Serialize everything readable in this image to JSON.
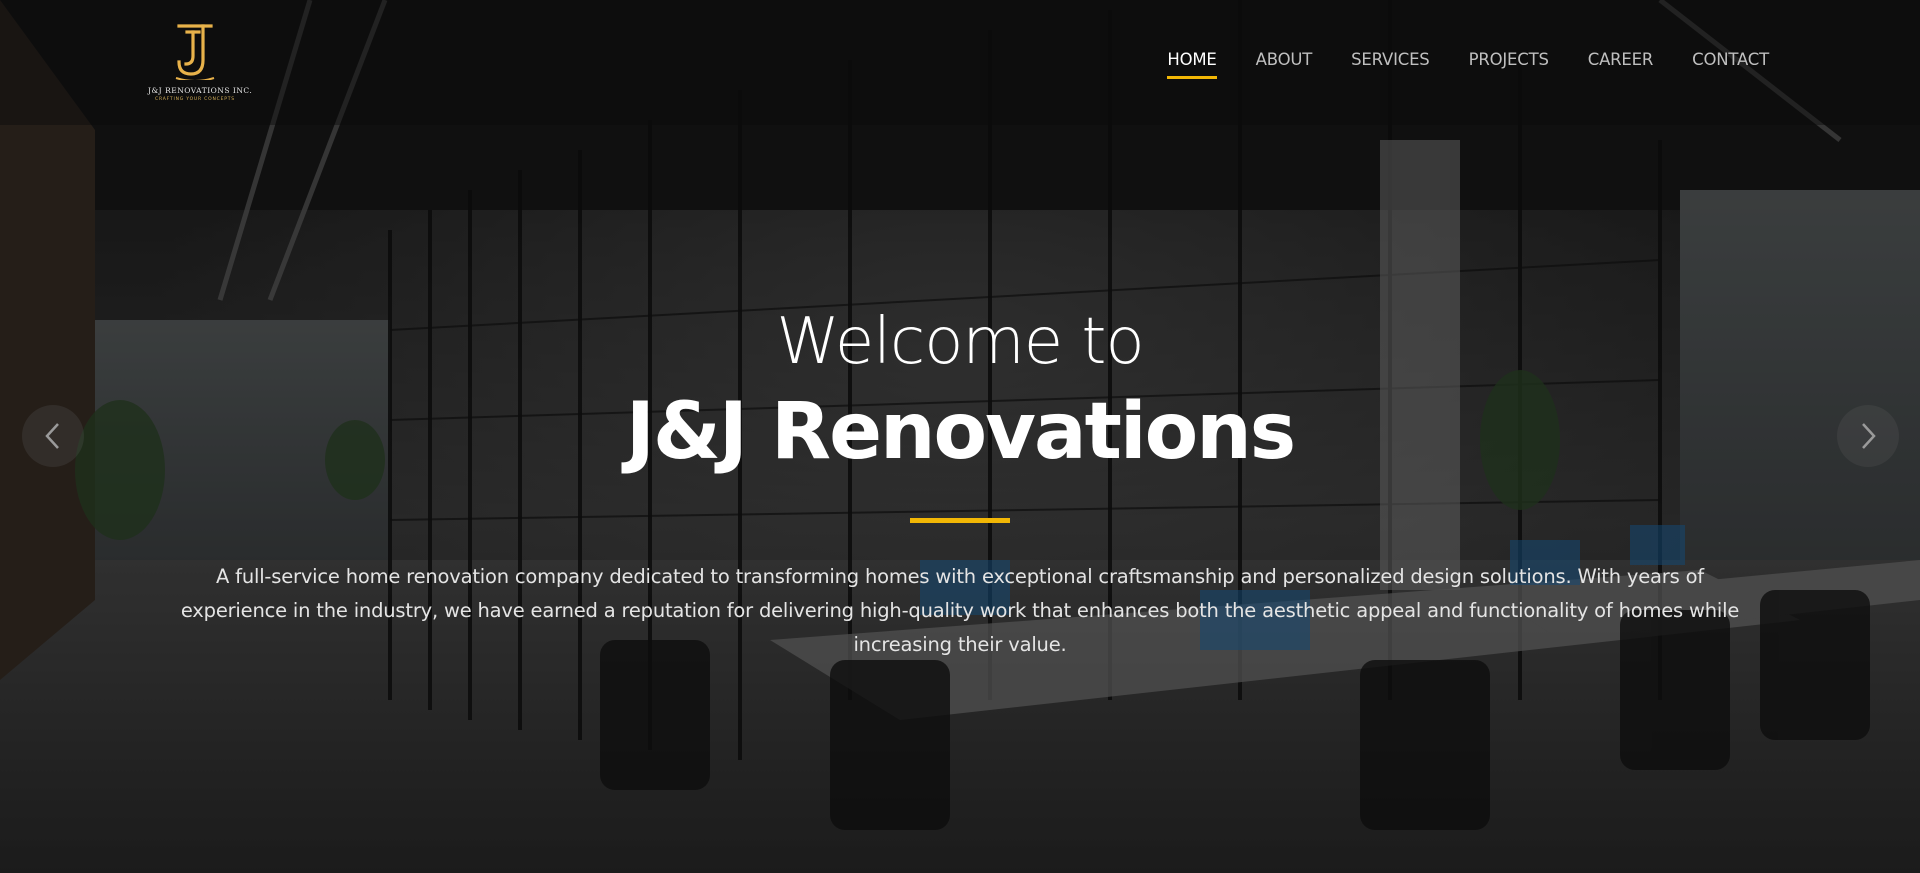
{
  "logo": {
    "name": "J&J RENOVATIONS INC.",
    "tagline": "CRAFTING YOUR CONCEPTS",
    "icon": "jj-monogram-icon",
    "color": "#e8b24a"
  },
  "nav": {
    "items": [
      {
        "label": "HOME",
        "active": true
      },
      {
        "label": "ABOUT",
        "active": false
      },
      {
        "label": "SERVICES",
        "active": false
      },
      {
        "label": "PROJECTS",
        "active": false
      },
      {
        "label": "CAREER",
        "active": false
      },
      {
        "label": "CONTACT",
        "active": false
      }
    ]
  },
  "carousel": {
    "prev_icon": "chevron-left-icon",
    "next_icon": "chevron-right-icon"
  },
  "hero": {
    "welcome": "Welcome to",
    "title": "J&J Renovations",
    "description": "A full-service home renovation company dedicated to transforming homes with exceptional craftsmanship and personalized design solutions. With years of experience in the industry, we have earned a reputation for delivering high-quality work that enhances both the aesthetic appeal and functionality of homes while increasing their value."
  },
  "colors": {
    "accent": "#f2b705",
    "text": "#ffffff"
  }
}
